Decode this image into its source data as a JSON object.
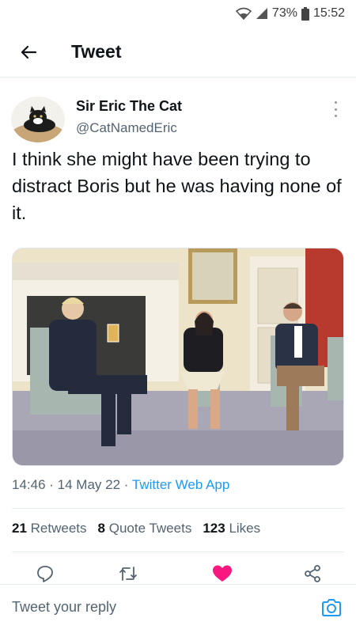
{
  "status_bar": {
    "battery": "73%",
    "time": "15:52"
  },
  "header": {
    "title": "Tweet"
  },
  "tweet": {
    "author_name": "Sir Eric The Cat",
    "author_handle": "@CatNamedEric",
    "text": "I think she might have been trying to distract Boris but he was having none of it.",
    "time": "14:46",
    "date": "14 May 22",
    "source": "Twitter Web App"
  },
  "stats": {
    "retweets_count": "21",
    "retweets_label": "Retweets",
    "quotes_count": "8",
    "quotes_label": "Quote Tweets",
    "likes_count": "123",
    "likes_label": "Likes"
  },
  "reply": {
    "placeholder": "Tweet your reply"
  },
  "colors": {
    "accent": "#1d9bf0",
    "like": "#f91880"
  }
}
